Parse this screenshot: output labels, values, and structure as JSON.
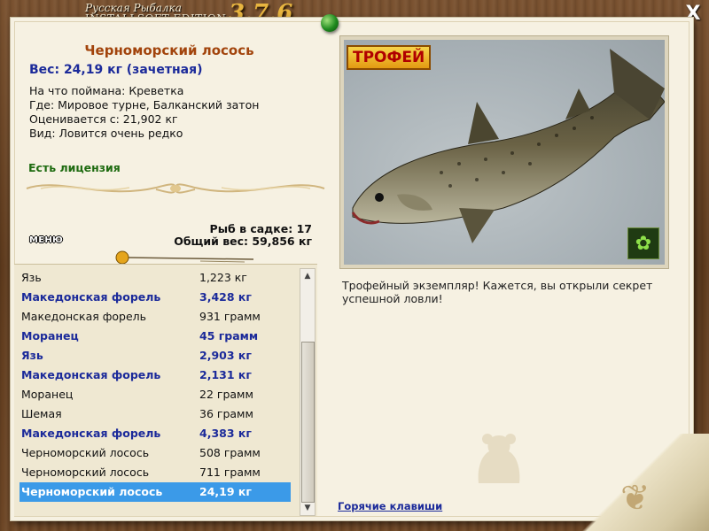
{
  "window": {
    "title_line1": "Русская Рыбалка",
    "title_line2": "INSTALLSOFT EDITION",
    "version": "3.7.6",
    "close_label": "X"
  },
  "catch": {
    "name": "Черноморский лосось",
    "weight": "Вес: 24,19 кг (зачетная)",
    "bait": "На что поймана: Креветка",
    "location": "Где: Мировое турне, Балканский затон",
    "evaluated": "Оценивается с: 21,902 кг",
    "rarity": "Вид: Ловится очень редко",
    "license": "Есть лицензия"
  },
  "net": {
    "count": "Рыб в садке: 17",
    "total": "Общий вес: 59,856 кг"
  },
  "menu_label": "МЕНЮ",
  "photo": {
    "badge": "ТРОФЕЙ",
    "butterfly_icon": "butterfly-icon"
  },
  "trophy_message": "Трофейный экземпляр! Кажется, вы открыли секрет успешной ловли!",
  "hotkeys_label": "Горячие клавиши",
  "fish_list": [
    {
      "name": "Язь",
      "weight": "1,223 кг",
      "bold": false
    },
    {
      "name": "Македонская форель",
      "weight": "3,428 кг",
      "bold": true
    },
    {
      "name": "Македонская форель",
      "weight": "931 грамм",
      "bold": false
    },
    {
      "name": "Моранец",
      "weight": "45 грамм",
      "bold": true
    },
    {
      "name": "Язь",
      "weight": "2,903 кг",
      "bold": true
    },
    {
      "name": "Македонская форель",
      "weight": "2,131 кг",
      "bold": true
    },
    {
      "name": "Моранец",
      "weight": "22 грамм",
      "bold": false
    },
    {
      "name": "Шемая",
      "weight": "36 грамм",
      "bold": false
    },
    {
      "name": "Македонская форель",
      "weight": "4,383 кг",
      "bold": true
    },
    {
      "name": "Черноморский лосось",
      "weight": "508 грамм",
      "bold": false
    },
    {
      "name": "Черноморский лосось",
      "weight": "711 грамм",
      "bold": false
    },
    {
      "name": "Черноморский лосось",
      "weight": "24,19 кг",
      "bold": true,
      "selected": true
    }
  ],
  "colors": {
    "accent_blue": "#1b2a9a",
    "fish_name": "#a2440c",
    "license_green": "#1e6b10",
    "selection": "#3b9ae8"
  }
}
